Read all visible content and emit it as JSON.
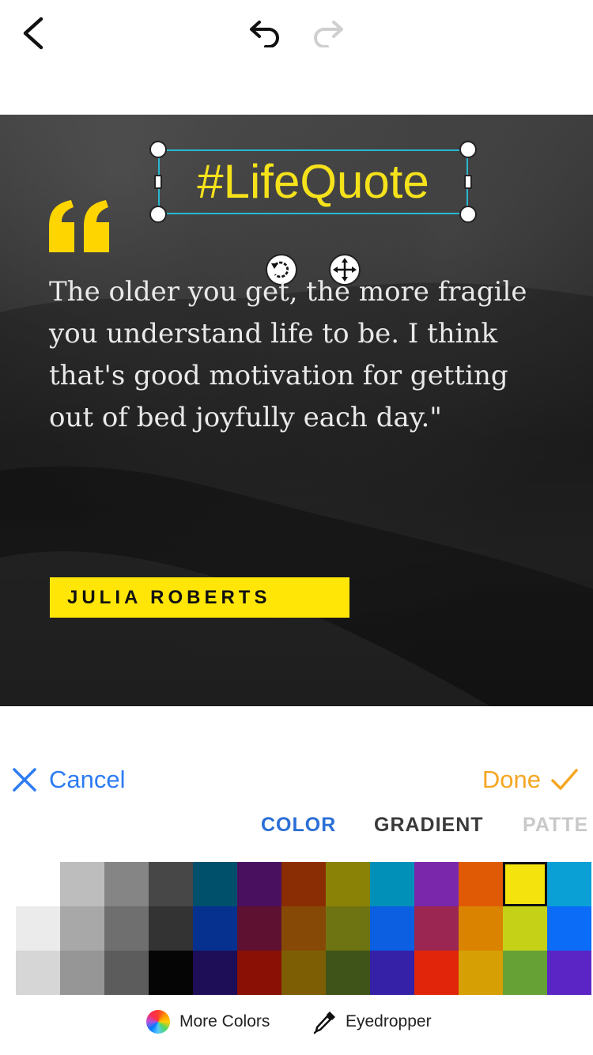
{
  "toolbar": {
    "back_icon": "chevron-left-icon",
    "undo_icon": "undo-icon",
    "redo_icon": "redo-icon",
    "redo_enabled": false
  },
  "canvas": {
    "hashtag": "#LifeQuote",
    "hashtag_color": "#f5e21b",
    "selection_color": "#28b8d0",
    "quote_mark_icon": "quote-mark-icon",
    "quote_text": "The older you get, the more fragile you understand life to be. I think that's good motivation for getting out of bed joyfully each day.\"",
    "author": "JULIA ROBERTS",
    "author_bg": "#ffe607",
    "rotate_icon": "rotate-icon",
    "move_icon": "move-icon"
  },
  "panel": {
    "cancel_label": "Cancel",
    "done_label": "Done",
    "tabs": [
      "COLOR",
      "GRADIENT",
      "PATTE"
    ],
    "active_tab": "COLOR",
    "more_colors_label": "More Colors",
    "eyedropper_label": "Eyedropper",
    "selected_swatch": "#f5e30d",
    "palette": [
      [
        "#ffffff",
        "#bdbdbd",
        "#858585",
        "#474747",
        "#004f6b",
        "#4a1060",
        "#8a2d04",
        "#8a8207",
        "#0090b8",
        "#7a27ac",
        "#e05a06",
        "#f5e30d",
        "#0aa0d6"
      ],
      [
        "#ebebeb",
        "#a8a8a8",
        "#6f6f6f",
        "#333333",
        "#06318f",
        "#5e1130",
        "#874a06",
        "#6f7412",
        "#0b5fe0",
        "#9c2652",
        "#d98300",
        "#c5d116",
        "#0a6cf7"
      ],
      [
        "#d6d6d6",
        "#969696",
        "#5c5c5c",
        "#050505",
        "#1d0e57",
        "#8a1005",
        "#7d5e05",
        "#3e5419",
        "#3521a8",
        "#e0250a",
        "#d6a004",
        "#65a135",
        "#5a25c4"
      ]
    ]
  }
}
